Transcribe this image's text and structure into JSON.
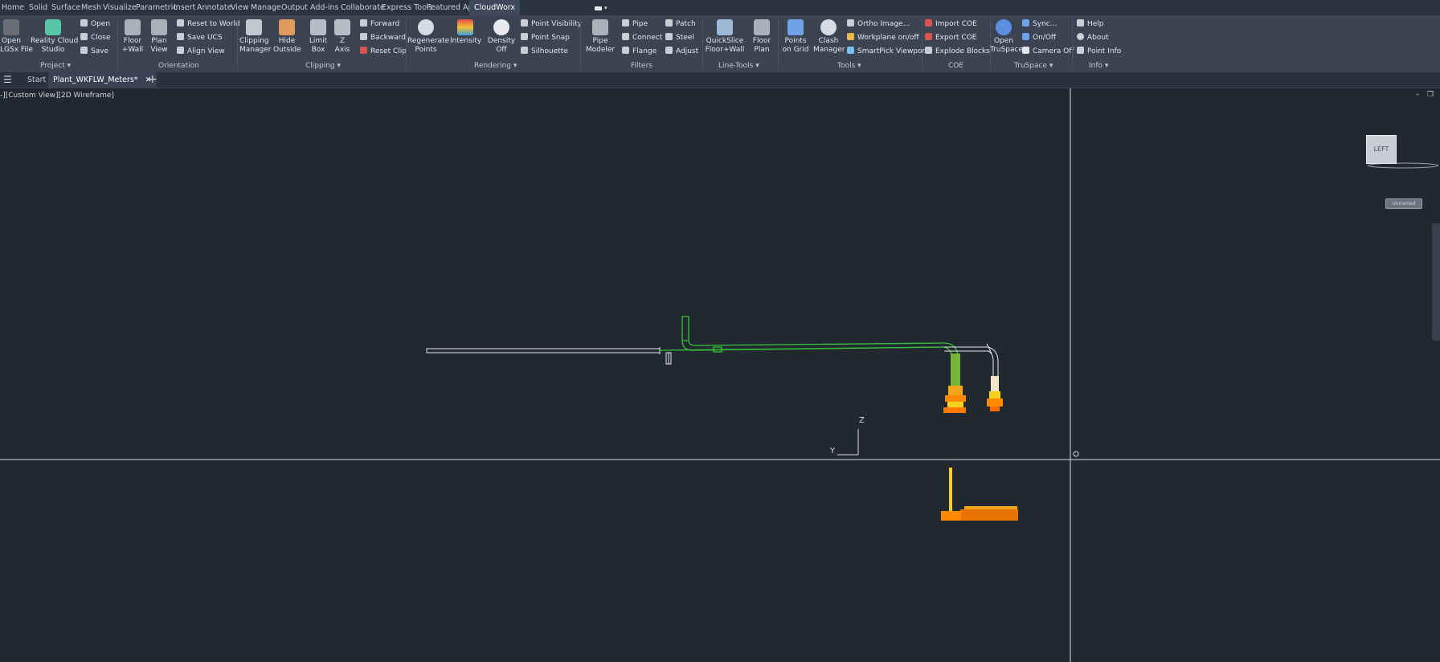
{
  "menu_tabs": [
    "Home",
    "Solid",
    "Surface",
    "Mesh",
    "Visualize",
    "Parametric",
    "Insert",
    "Annotate",
    "View",
    "Manage",
    "Output",
    "Add-ins",
    "Collaborate",
    "Express Tools",
    "Featured Apps",
    "CloudWorx"
  ],
  "active_tab": "CloudWorx",
  "ribbon": {
    "project": {
      "open_lgs": "Open\nLGSx File",
      "reality": "Reality Cloud\nStudio",
      "open": "Open",
      "close": "Close",
      "save": "Save",
      "label": "Project"
    },
    "orientation": {
      "floor_wall": "Floor\n+Wall",
      "plan_view": "Plan\nView",
      "reset_world": "Reset to World",
      "save_ucs": "Save UCS",
      "align_view": "Align View",
      "label": "Orientation"
    },
    "clipping": {
      "clipping_manager": "Clipping\nManager",
      "hide_outside": "Hide\nOutside",
      "limit_box": "Limit\nBox",
      "z_axis": "Z\nAxis",
      "forward": "Forward",
      "backward": "Backward",
      "reset_clip": "Reset Clip",
      "label": "Clipping"
    },
    "rendering": {
      "regenerate": "Regenerate\nPoints",
      "intensity": "Intensity",
      "density": "Density\nOff",
      "point_visibility": "Point Visibility",
      "point_snap": "Point Snap",
      "silhouette": "Silhouette",
      "label": "Rendering"
    },
    "filters": {
      "pipe_modeler": "Pipe\nModeler",
      "pipe": "Pipe",
      "connect": "Connect",
      "flange": "Flange",
      "patch": "Patch",
      "steel": "Steel",
      "adjust": "Adjust",
      "label": "Filters"
    },
    "line_tools": {
      "quickslice": "QuickSlice\nFloor+Wall",
      "floor_plan": "Floor\nPlan",
      "label": "Line-Tools"
    },
    "tools": {
      "points_grid": "Points\non Grid",
      "clash": "Clash\nManager",
      "ortho": "Ortho Image...",
      "workplane": "Workplane on/off",
      "smartpick": "SmartPick Viewport",
      "label": "Tools"
    },
    "coe": {
      "import": "Import COE",
      "export": "Export COE",
      "explode": "Explode Blocks",
      "label": "COE"
    },
    "truspace": {
      "open": "Open\nTruSpace",
      "sync": "Sync...",
      "onoff": "On/Off",
      "camera": "Camera Off",
      "label": "TruSpace"
    },
    "info": {
      "help": "Help",
      "about": "About",
      "point_info": "Point Info",
      "label": "Info"
    }
  },
  "doc_tabs": {
    "start": "Start",
    "active": "Plant_WKFLW_Meters*"
  },
  "viewport": {
    "label": "-][Custom View][2D Wireframe]",
    "viewcube": "LEFT",
    "unnamed": "Unnamed",
    "axis_z": "Z",
    "axis_y": "Y"
  },
  "colors": {
    "background": "#212830",
    "ribbon": "#3b4453",
    "pipe_green": "#37c23a",
    "point_orange": "#ff8a00",
    "point_yellow": "#f5d31a"
  }
}
